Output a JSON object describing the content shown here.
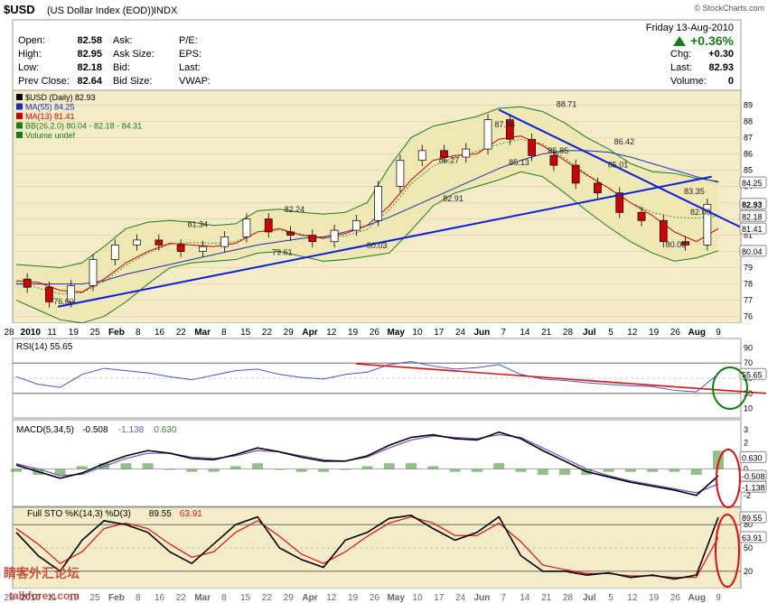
{
  "header": {
    "symbol": "$USD",
    "name": "(US Dollar Index (EOD))",
    "exchange": "INDX",
    "source": "© StockCharts.com",
    "date": "Friday  13-Aug-2010",
    "change_pct": "+0.36%",
    "quote_left": [
      {
        "label": "Open:",
        "value": "82.58"
      },
      {
        "label": "High:",
        "value": "82.95"
      },
      {
        "label": "Low:",
        "value": "82.18"
      },
      {
        "label": "Prev Close:",
        "value": "82.64"
      }
    ],
    "quote_mid": [
      "Ask:",
      "Ask Size:",
      "Bid:",
      "Bid Size:"
    ],
    "quote_fields": [
      "P/E:",
      "EPS:",
      "Last:",
      "VWAP:"
    ],
    "quote_right": [
      {
        "label": "Chg:",
        "value": "+0.30"
      },
      {
        "label": "Last:",
        "value": "82.93"
      },
      {
        "label": "Volume:",
        "value": "0"
      }
    ]
  },
  "colors": {
    "panel_bg": "#f4ecc8",
    "bb_fill": "#efe7b4",
    "up_candle": "#ffffff",
    "down_candle": "#cc0000",
    "ma55": "#1b2fb5",
    "ma13": "#cc0000",
    "bb": "#1a7a1a",
    "trendline": "#0a1ee0",
    "rsi": "#4455cc",
    "rsi_trend": "#e01010",
    "macd": "#000000",
    "signal": "#7a4dc8",
    "hist": "#3a8a2a",
    "stoch_k": "#000000",
    "stoch_d": "#d81010",
    "highlight_green": "#0d7d0d",
    "highlight_red": "#d41010"
  },
  "chart_data": [
    {
      "type": "candlestick",
      "legend": [
        "$USD (Daily) 82.93",
        "MA(55) 84.25",
        "MA(13) 81.41",
        "BB(26,2.0) 80.04 - 82.18 - 84.31",
        "Volume undef"
      ],
      "ylim": [
        75.7,
        89.8
      ],
      "yticks": [
        76,
        77,
        78,
        79,
        80,
        81,
        82,
        83,
        84,
        85,
        86,
        87,
        88,
        89
      ],
      "xtick_labels": [
        "28",
        "2010",
        "11",
        "19",
        "25",
        "Feb",
        "8",
        "16",
        "22",
        "Mar",
        "8",
        "15",
        "22",
        "29",
        "Apr",
        "12",
        "19",
        "26",
        "May",
        "10",
        "17",
        "24",
        "Jun",
        "7",
        "14",
        "21",
        "28",
        "Jul",
        "5",
        "12",
        "19",
        "26",
        "Aug",
        "9"
      ],
      "xtick_bold": [
        "2010",
        "Feb",
        "Mar",
        "Apr",
        "May",
        "Jun",
        "Jul",
        "Aug"
      ],
      "annotations": [
        {
          "label": "76.60",
          "price": 76.6
        },
        {
          "label": "81.34",
          "price": 81.34
        },
        {
          "label": "82.24",
          "price": 82.24
        },
        {
          "label": "79.61",
          "price": 79.61
        },
        {
          "label": "80.03",
          "price": 80.03
        },
        {
          "label": "85.27",
          "price": 85.27
        },
        {
          "label": "87.46",
          "price": 87.46
        },
        {
          "label": "82.91",
          "price": 82.91
        },
        {
          "label": "85.13",
          "price": 85.13
        },
        {
          "label": "85.85",
          "price": 85.85
        },
        {
          "label": "88.71",
          "price": 88.71
        },
        {
          "label": "86.42",
          "price": 86.42
        },
        {
          "label": "85.01",
          "price": 85.01
        },
        {
          "label": "83.35",
          "price": 83.35
        },
        {
          "label": "82.08",
          "price": 82.08
        },
        {
          "label": "80.08",
          "price": 80.08
        }
      ],
      "right_tags": [
        {
          "label": "84.25",
          "value": 84.25
        },
        {
          "label": "82.93",
          "value": 82.93
        },
        {
          "label": "82.18",
          "value": 82.18
        },
        {
          "label": "81.41",
          "value": 81.41
        },
        {
          "label": "80.04",
          "value": 80.04
        }
      ],
      "closes_weekly": [
        78.3,
        77.8,
        76.9,
        77.9,
        79.5,
        80.4,
        80.7,
        80.4,
        80.0,
        80.3,
        80.9,
        82.0,
        81.2,
        81.0,
        80.6,
        81.3,
        81.9,
        84.0,
        85.6,
        86.2,
        85.8,
        86.3,
        88.1,
        86.9,
        85.9,
        85.3,
        84.2,
        83.6,
        82.4,
        81.9,
        80.6,
        80.4,
        82.9
      ],
      "ma55_weekly": [
        78.0,
        78.0,
        78.0,
        78.0,
        78.2,
        78.6,
        78.9,
        79.2,
        79.5,
        79.8,
        80.1,
        80.4,
        80.6,
        80.8,
        80.9,
        81.2,
        81.6,
        82.1,
        82.7,
        83.3,
        83.9,
        84.5,
        85.1,
        85.6,
        86.0,
        86.2,
        86.2,
        86.1,
        85.8,
        85.4,
        85.0,
        84.6,
        84.25
      ],
      "ma13_weekly": [
        78.2,
        78.1,
        77.6,
        77.5,
        78.3,
        79.3,
        80.0,
        80.5,
        80.4,
        80.3,
        80.5,
        81.2,
        81.4,
        81.0,
        80.8,
        81.1,
        81.6,
        82.8,
        84.4,
        85.6,
        85.9,
        86.0,
        86.9,
        87.1,
        86.5,
        85.6,
        84.7,
        83.9,
        83.0,
        82.2,
        81.2,
        80.6,
        81.41
      ],
      "bb_upper_weekly": [
        79.2,
        79.1,
        79.0,
        79.3,
        80.3,
        81.4,
        81.8,
        81.9,
        81.8,
        81.6,
        81.7,
        82.5,
        82.6,
        82.4,
        82.3,
        82.4,
        83.0,
        85.2,
        87.0,
        87.7,
        88.0,
        88.3,
        88.8,
        88.9,
        88.6,
        87.9,
        87.0,
        86.3,
        85.4,
        84.9,
        84.8,
        84.5,
        84.31
      ],
      "bb_lower_weekly": [
        77.0,
        76.4,
        75.8,
        75.6,
        76.0,
        76.9,
        78.0,
        79.0,
        79.3,
        79.4,
        79.5,
        79.9,
        80.0,
        79.7,
        79.4,
        79.5,
        79.7,
        79.9,
        81.3,
        82.8,
        83.6,
        84.0,
        84.4,
        84.9,
        84.6,
        83.6,
        82.5,
        81.5,
        80.6,
        79.9,
        79.4,
        79.6,
        80.04
      ],
      "trendlines": [
        {
          "from_week": 1.9,
          "from_price": 76.6,
          "to_week": 31.7,
          "to_price": 84.6
        },
        {
          "from_week": 22.0,
          "from_price": 88.71,
          "to_week": 33.0,
          "to_price": 81.5
        }
      ]
    },
    {
      "type": "line",
      "name": "RSI(14) 55.65",
      "ylim": [
        0,
        100
      ],
      "yticks": [
        90,
        70,
        50,
        30,
        10
      ],
      "reference_lines": [
        70,
        30
      ],
      "tag": "55.65",
      "values_weekly": [
        52,
        42,
        38,
        55,
        63,
        60,
        57,
        52,
        48,
        54,
        60,
        62,
        55,
        51,
        49,
        55,
        58,
        68,
        72,
        66,
        62,
        64,
        68,
        55,
        49,
        47,
        44,
        42,
        40,
        39,
        34,
        32,
        55.65
      ]
    },
    {
      "type": "line",
      "name": "MACD(5,34,5) -0.508, -1.138, 0.630",
      "legend": [
        "MACD(5,34,5)",
        "-0.508",
        "-1.138",
        "0.630"
      ],
      "ylim": [
        -2.7,
        3.6
      ],
      "yticks": [
        3,
        2,
        1,
        0,
        -1,
        -2
      ],
      "tags": [
        "0.630",
        "-0.508",
        "-1.138"
      ],
      "macd_weekly": [
        0.3,
        -0.2,
        -0.7,
        -0.3,
        0.4,
        1.0,
        1.4,
        1.2,
        0.8,
        0.7,
        1.1,
        1.6,
        1.3,
        0.9,
        0.6,
        0.6,
        1.0,
        1.8,
        2.4,
        2.6,
        2.3,
        2.2,
        2.8,
        2.3,
        1.4,
        0.6,
        -0.2,
        -0.6,
        -1.0,
        -1.3,
        -1.6,
        -2.0,
        -0.508
      ],
      "signal_weekly": [
        0.4,
        0.0,
        -0.5,
        -0.4,
        0.2,
        0.8,
        1.2,
        1.2,
        0.9,
        0.8,
        1.0,
        1.4,
        1.3,
        1.0,
        0.7,
        0.6,
        0.9,
        1.6,
        2.2,
        2.5,
        2.4,
        2.3,
        2.6,
        2.4,
        1.6,
        0.8,
        0.0,
        -0.5,
        -0.9,
        -1.2,
        -1.5,
        -1.8,
        -1.138
      ],
      "hist_weekly": [
        -0.1,
        -0.2,
        -0.2,
        0.1,
        0.2,
        0.2,
        0.2,
        0.0,
        -0.1,
        -0.1,
        0.1,
        0.2,
        0.0,
        -0.1,
        -0.1,
        0.0,
        0.1,
        0.2,
        0.2,
        0.1,
        -0.1,
        -0.1,
        0.2,
        -0.1,
        -0.2,
        -0.2,
        -0.2,
        -0.1,
        -0.1,
        -0.1,
        -0.1,
        -0.2,
        0.63
      ]
    },
    {
      "type": "line",
      "name": "Full STO %K(14,3) %D(3) 89.55, 63.91",
      "legend": [
        "Full STO %K(14,3) %D(3)",
        "89.55",
        "63.91"
      ],
      "ylim": [
        0,
        100
      ],
      "yticks": [
        80,
        50,
        20
      ],
      "reference_lines": [
        80,
        20
      ],
      "tags": [
        "89.55",
        "63.91"
      ],
      "k_weekly": [
        70,
        40,
        20,
        60,
        85,
        80,
        70,
        45,
        30,
        55,
        80,
        90,
        50,
        35,
        25,
        60,
        70,
        88,
        92,
        75,
        60,
        70,
        90,
        40,
        20,
        20,
        15,
        18,
        12,
        15,
        10,
        15,
        89.55
      ],
      "d_weekly": [
        75,
        55,
        30,
        45,
        75,
        82,
        75,
        55,
        38,
        45,
        70,
        85,
        65,
        42,
        30,
        45,
        65,
        82,
        90,
        82,
        66,
        66,
        82,
        58,
        28,
        22,
        17,
        17,
        14,
        14,
        12,
        12,
        63.91
      ]
    }
  ],
  "watermark": {
    "cn": "睛客外汇论坛",
    "site": "talkforex.com"
  }
}
